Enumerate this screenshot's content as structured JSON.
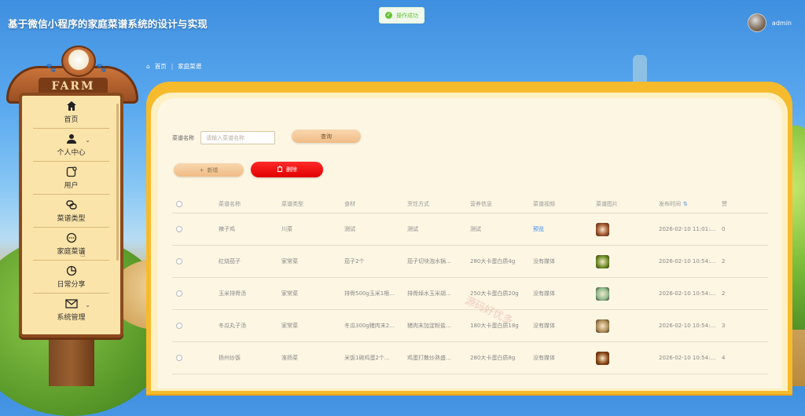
{
  "app": {
    "title": "基于微信小程序的家庭菜谱系统的设计与实现"
  },
  "toast": {
    "message": "操作成功",
    "icon": "check-circle-icon"
  },
  "user": {
    "name": "admin"
  },
  "sign": {
    "board_text": "FARM"
  },
  "sidebar": {
    "items": [
      {
        "label": "首页",
        "icon": "home-icon"
      },
      {
        "label": "个人中心",
        "icon": "user-icon",
        "has_caret": true
      },
      {
        "label": "用户",
        "icon": "user-edit-icon"
      },
      {
        "label": "菜谱类型",
        "icon": "link-icon"
      },
      {
        "label": "家庭菜谱",
        "icon": "chat-bubble-icon"
      },
      {
        "label": "日常分享",
        "icon": "pie-chart-icon"
      },
      {
        "label": "系统管理",
        "icon": "mail-icon",
        "has_caret": true
      }
    ]
  },
  "breadcrumb": {
    "home": "首页",
    "current": "家庭菜谱"
  },
  "search": {
    "label": "菜谱名称",
    "placeholder": "请输入菜谱名称",
    "button": "查询"
  },
  "actions": {
    "add": "新增",
    "delete": "删除"
  },
  "table": {
    "columns": [
      "菜谱名称",
      "菜谱类型",
      "食材",
      "烹饪方式",
      "营养信息",
      "菜谱视频",
      "菜谱图片",
      "发布时间",
      "赞"
    ],
    "rows": [
      {
        "name": "辣子鸡",
        "type": "川菜",
        "ingredients": "测试",
        "method": "测试",
        "nutrition": "测试",
        "video": "预览",
        "video_is_link": true,
        "published": "2026-02-10 11:01:…",
        "likes": "0",
        "thumb_color": "#a0522d"
      },
      {
        "name": "红烧茄子",
        "type": "家常菜",
        "ingredients": "茄子2个",
        "method": "茄子切块泡水锅…",
        "nutrition": "280大卡蛋白质4g",
        "video": "没有媒体",
        "video_is_link": false,
        "published": "2026-02-10 10:54:…",
        "likes": "2",
        "thumb_color": "#6b8e23"
      },
      {
        "name": "玉米排骨汤",
        "type": "家常菜",
        "ingredients": "排骨500g玉米1根…",
        "method": "排骨焯水玉米胡…",
        "nutrition": "250大卡蛋白质20g",
        "video": "没有媒体",
        "video_is_link": false,
        "published": "2026-02-10 10:54:…",
        "likes": "2",
        "thumb_color": "#8fbc8f"
      },
      {
        "name": "冬瓜丸子汤",
        "type": "家常菜",
        "ingredients": "冬瓜300g猪肉末2…",
        "method": "猪肉末加淀粉盐…",
        "nutrition": "180大卡蛋白质18g",
        "video": "没有媒体",
        "video_is_link": false,
        "published": "2026-02-10 10:54:…",
        "likes": "3",
        "thumb_color": "#b08d57"
      },
      {
        "name": "扬州炒饭",
        "type": "淮扬菜",
        "ingredients": "米饭1碗鸡蛋2个…",
        "method": "鸡蛋打散炒熟盛…",
        "nutrition": "280大卡蛋白质8g",
        "video": "没有媒体",
        "video_is_link": false,
        "published": "2026-02-10 10:54:…",
        "likes": "4",
        "thumb_color": "#8b4513"
      }
    ]
  },
  "watermark": "源码好优多"
}
